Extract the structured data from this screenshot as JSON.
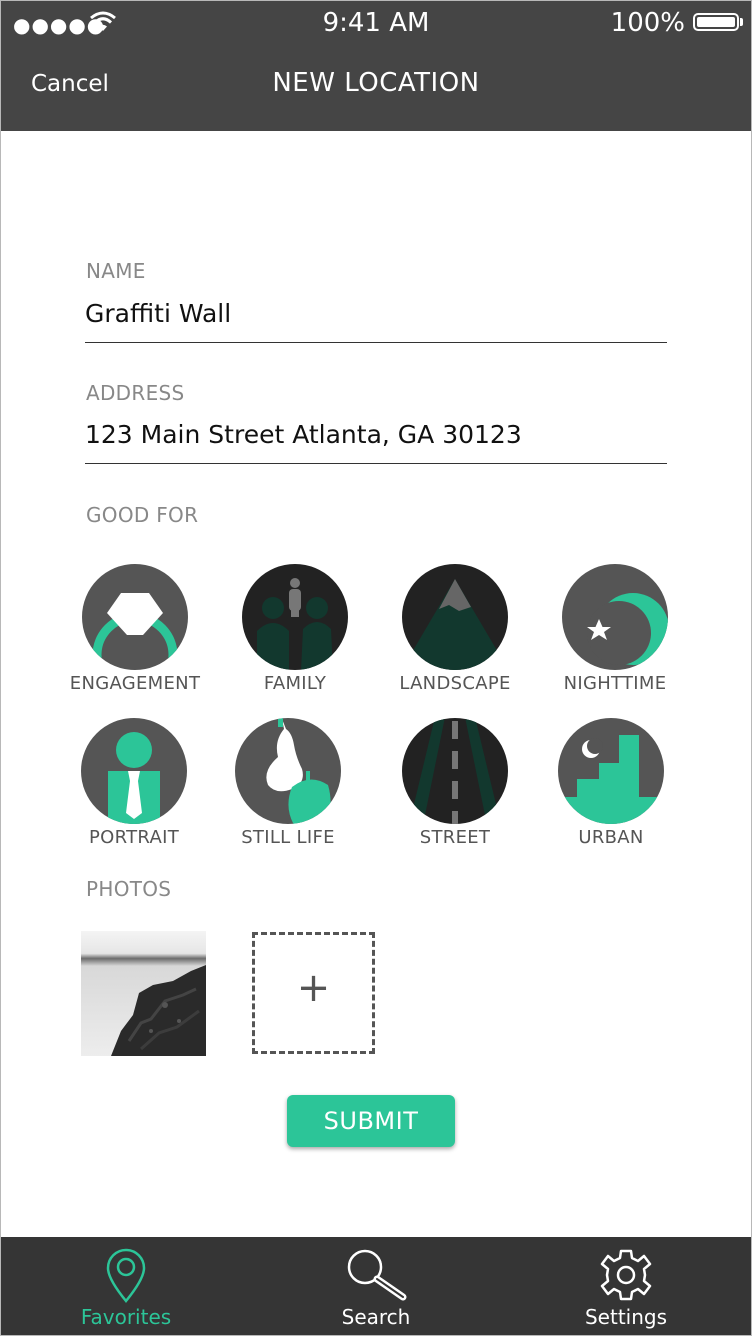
{
  "status_bar": {
    "signal": "●●●●●",
    "time": "9:41 AM",
    "battery": "100%"
  },
  "nav": {
    "cancel": "Cancel",
    "title": "NEW LOCATION"
  },
  "form": {
    "name_label": "NAME",
    "name_value": "Graffiti Wall",
    "address_label": "ADDRESS",
    "address_value": "123 Main Street Atlanta, GA 30123",
    "good_for_label": "GOOD FOR",
    "photos_label": "PHOTOS",
    "add_photo": "+",
    "submit": "SUBMIT"
  },
  "categories": [
    {
      "label": "ENGAGEMENT",
      "icon": "engagement-ring-icon"
    },
    {
      "label": "FAMILY",
      "icon": "family-icon"
    },
    {
      "label": "LANDSCAPE",
      "icon": "mountain-icon"
    },
    {
      "label": "NIGHTTIME",
      "icon": "moon-star-icon"
    },
    {
      "label": "PORTRAIT",
      "icon": "portrait-icon"
    },
    {
      "label": "STILL LIFE",
      "icon": "still-life-icon"
    },
    {
      "label": "STREET",
      "icon": "road-icon"
    },
    {
      "label": "URBAN",
      "icon": "city-stairs-icon"
    }
  ],
  "tabs": [
    {
      "label": "Favorites",
      "icon": "map-pin-icon",
      "active": true
    },
    {
      "label": "Search",
      "icon": "search-icon",
      "active": false
    },
    {
      "label": "Settings",
      "icon": "gear-icon",
      "active": false
    }
  ],
  "colors": {
    "accent": "#2cc598",
    "bar": "#454545",
    "tabbar": "#353535",
    "icon_bg": "#555555",
    "icon_dark": "#222222",
    "inactive_tab": "#ffffff"
  }
}
